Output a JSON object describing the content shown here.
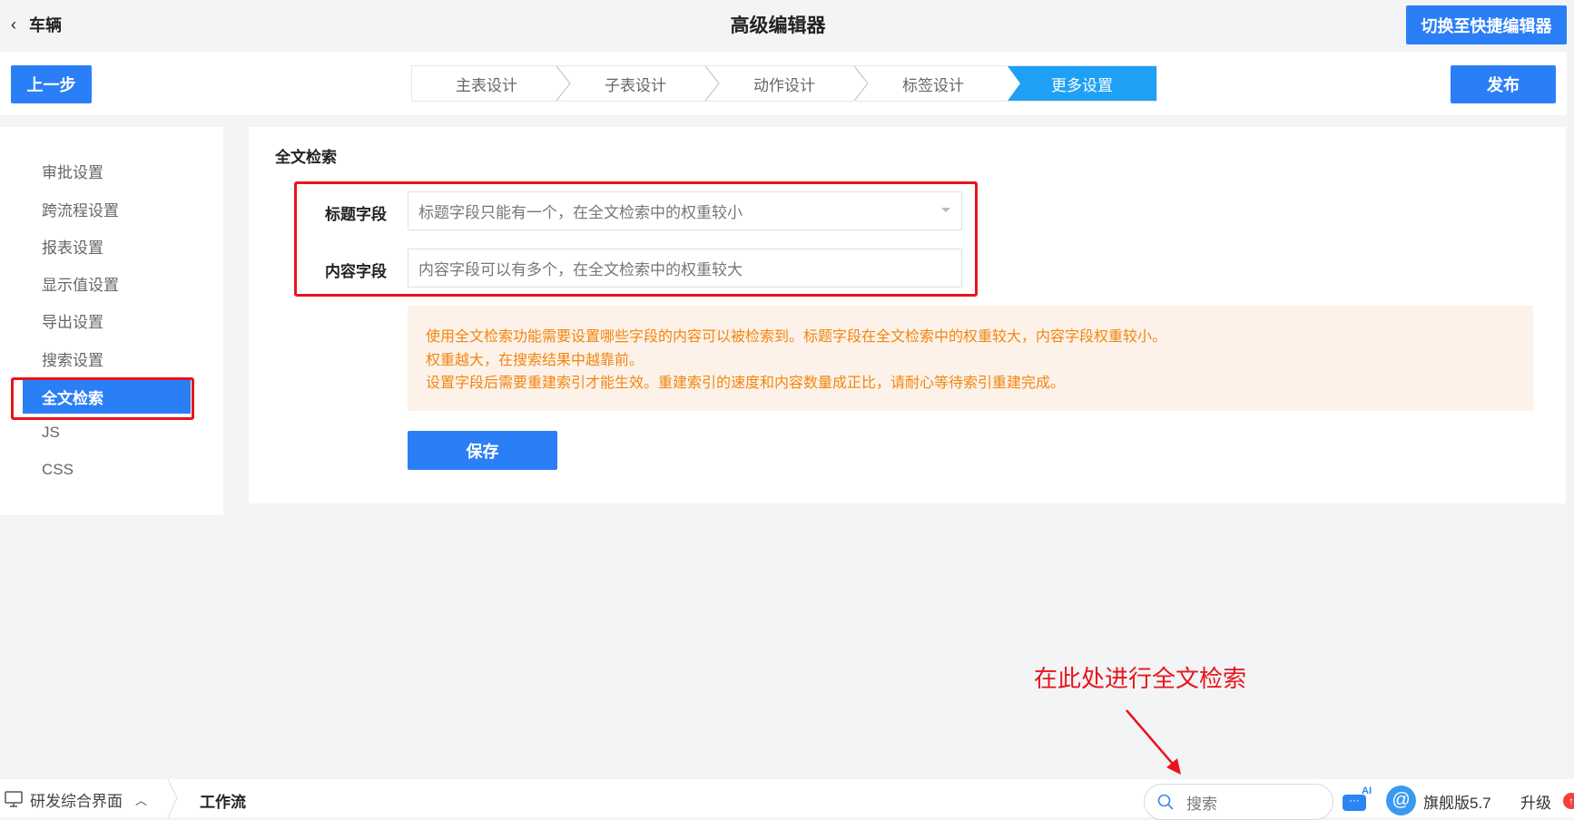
{
  "header": {
    "back_label": "车辆",
    "title": "高级编辑器",
    "switch_button": "切换至快捷编辑器"
  },
  "toolbar": {
    "prev_button": "上一步",
    "publish_button": "发布",
    "steps": [
      {
        "label": "主表设计"
      },
      {
        "label": "子表设计"
      },
      {
        "label": "动作设计"
      },
      {
        "label": "标签设计"
      },
      {
        "label": "更多设置"
      }
    ],
    "active_step": 4
  },
  "sidebar": {
    "items": [
      {
        "label": "审批设置"
      },
      {
        "label": "跨流程设置"
      },
      {
        "label": "报表设置"
      },
      {
        "label": "显示值设置"
      },
      {
        "label": "导出设置"
      },
      {
        "label": "搜索设置"
      },
      {
        "label": "全文检索"
      },
      {
        "label": "JS"
      },
      {
        "label": "CSS"
      }
    ],
    "active": 6
  },
  "main": {
    "section_title": "全文检索",
    "title_field_label": "标题字段",
    "title_field_placeholder": "标题字段只能有一个，在全文检索中的权重较小",
    "content_field_label": "内容字段",
    "content_field_placeholder": "内容字段可以有多个，在全文检索中的权重较大",
    "notice": [
      "使用全文检索功能需要设置哪些字段的内容可以被检索到。标题字段在全文检索中的权重较大，内容字段权重较小。",
      "权重越大，在搜索结果中越靠前。",
      "设置字段后需要重建索引才能生效。重建索引的速度和内容数量成正比，请耐心等待索引重建完成。"
    ],
    "save_button": "保存"
  },
  "annotation": {
    "text": "在此处进行全文检索",
    "color": "#e8141c"
  },
  "taskbar": {
    "workspace": "研发综合界面",
    "current": "工作流",
    "search_placeholder": "搜索",
    "ai_badge": "AI",
    "edition": "旗舰版5.7",
    "upgrade": "升级"
  },
  "colors": {
    "primary": "#2b7ff6",
    "step_active": "#1ea0f5",
    "notice_text": "#f0860f",
    "notice_bg": "#fdf2e9"
  }
}
